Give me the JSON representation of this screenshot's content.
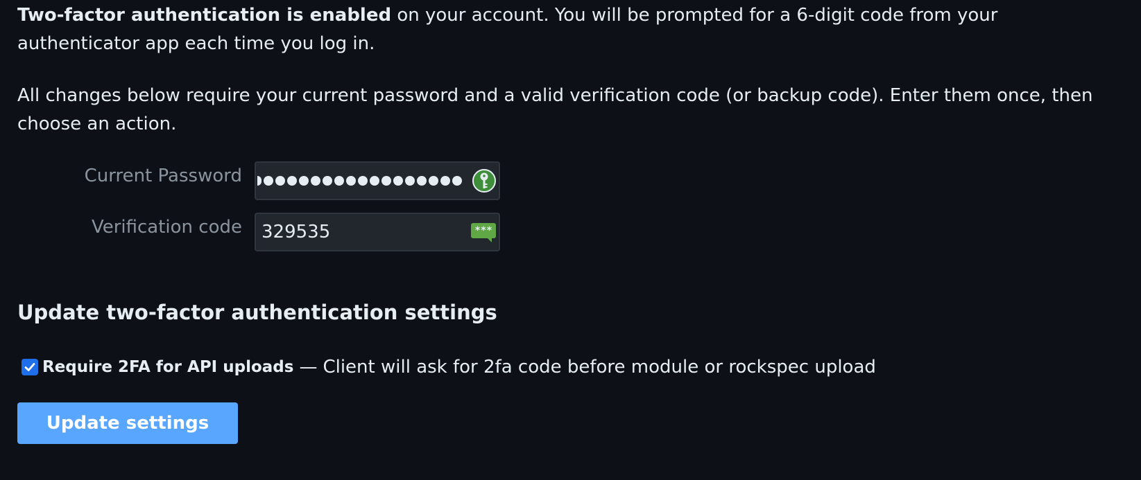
{
  "intro": {
    "status_bold": "Two-factor authentication is enabled",
    "status_rest": " on your account. You will be prompted for a 6-digit code from your authenticator app each time you log in.",
    "instructions": "All changes below require your current password and a valid verification code (or backup code). Enter them once, then choose an action."
  },
  "form": {
    "password_label": "Current Password",
    "password_icon": "key-icon",
    "code_label": "Verification code",
    "code_value": "329535",
    "code_icon_text": "***"
  },
  "settings": {
    "title": "Update two-factor authentication settings",
    "require_api_label": "Require 2FA for API uploads",
    "require_api_sep": "—",
    "require_api_desc": "Client will ask for 2fa code before module or rockspec upload",
    "require_api_checked": true,
    "submit_label": "Update settings"
  },
  "colors": {
    "background": "#0d1117",
    "accent": "#58a6ff",
    "checkbox": "#1f6feb",
    "key_badge": "#3f8f3a"
  }
}
